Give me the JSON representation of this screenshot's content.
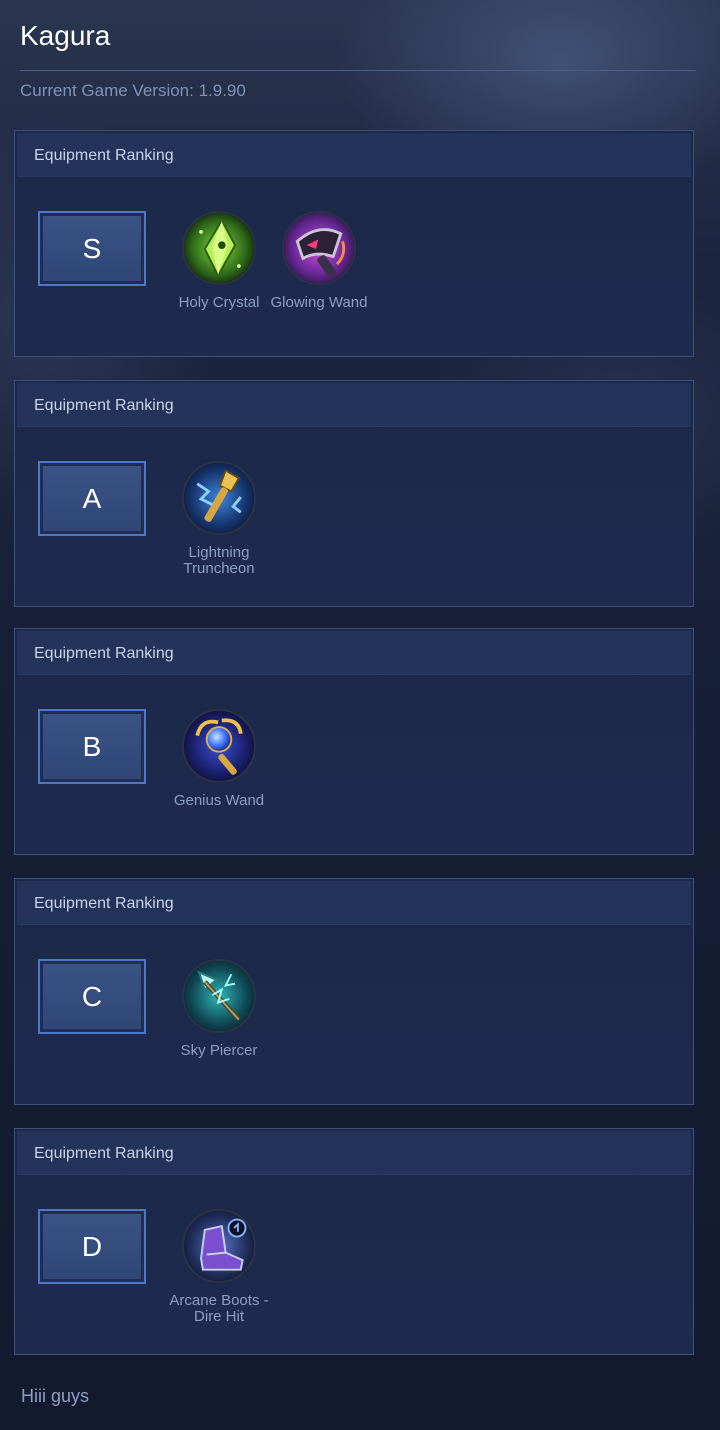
{
  "hero": {
    "name": "Kagura"
  },
  "version": {
    "label": "Current Game Version: 1.9.90"
  },
  "panels": [
    {
      "title": "Equipment Ranking",
      "tier": "S",
      "items": [
        {
          "name": "Holy Crystal",
          "icon": "holy-crystal-icon"
        },
        {
          "name": "Glowing Wand",
          "icon": "glowing-wand-icon"
        }
      ]
    },
    {
      "title": "Equipment Ranking",
      "tier": "A",
      "items": [
        {
          "name": "Lightning Truncheon",
          "icon": "lightning-truncheon-icon"
        }
      ]
    },
    {
      "title": "Equipment Ranking",
      "tier": "B",
      "items": [
        {
          "name": "Genius Wand",
          "icon": "genius-wand-icon"
        }
      ]
    },
    {
      "title": "Equipment Ranking",
      "tier": "C",
      "items": [
        {
          "name": "Sky Piercer",
          "icon": "sky-piercer-icon"
        }
      ]
    },
    {
      "title": "Equipment Ranking",
      "tier": "D",
      "items": [
        {
          "name": "Arcane Boots - Dire Hit",
          "icon": "arcane-boots-icon"
        }
      ]
    }
  ],
  "footer": {
    "text": "Hiii guys"
  }
}
